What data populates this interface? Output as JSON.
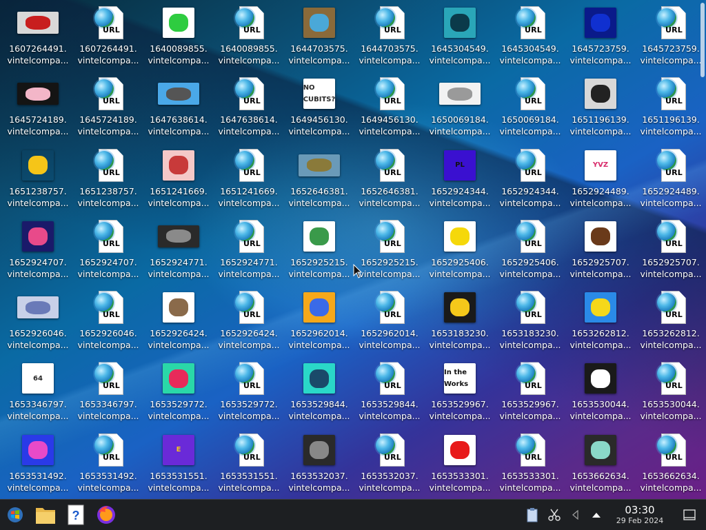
{
  "desktop": {
    "items": [
      {
        "kind": "image",
        "title": "1607264491.",
        "subtitle": "vintelcompa...",
        "thumb": {
          "bg": "#d8d8d8",
          "fg": "#c81e1e",
          "text": "",
          "wide": true
        }
      },
      {
        "kind": "url",
        "title": "1607264491.",
        "subtitle": "vintelcompa..."
      },
      {
        "kind": "image",
        "title": "1640089855.",
        "subtitle": "vintelcompa...",
        "thumb": {
          "bg": "#ffffff",
          "fg": "#2ecc40",
          "text": "",
          "wide": false
        }
      },
      {
        "kind": "url",
        "title": "1640089855.",
        "subtitle": "vintelcompa..."
      },
      {
        "kind": "image",
        "title": "1644703575.",
        "subtitle": "vintelcompa...",
        "thumb": {
          "bg": "#8a6a3a",
          "fg": "#4aa8d8",
          "text": "",
          "wide": false
        }
      },
      {
        "kind": "url",
        "title": "1644703575.",
        "subtitle": "vintelcompa..."
      },
      {
        "kind": "image",
        "title": "1645304549.",
        "subtitle": "vintelcompa...",
        "thumb": {
          "bg": "#2aa6b8",
          "fg": "#0b3a4a",
          "text": "",
          "wide": false
        }
      },
      {
        "kind": "url",
        "title": "1645304549.",
        "subtitle": "vintelcompa..."
      },
      {
        "kind": "image",
        "title": "1645723759.",
        "subtitle": "vintelcompa...",
        "thumb": {
          "bg": "#0a1a8a",
          "fg": "#1030d0",
          "text": "",
          "wide": false
        }
      },
      {
        "kind": "url",
        "title": "1645723759.",
        "subtitle": "vintelcompa..."
      },
      {
        "kind": "image",
        "title": "1645724189.",
        "subtitle": "vintelcompa...",
        "thumb": {
          "bg": "#141414",
          "fg": "#f3b6c8",
          "text": "",
          "wide": true
        }
      },
      {
        "kind": "url",
        "title": "1645724189.",
        "subtitle": "vintelcompa..."
      },
      {
        "kind": "image",
        "title": "1647638614.",
        "subtitle": "vintelcompa...",
        "thumb": {
          "bg": "#4aa8e8",
          "fg": "#555555",
          "text": "",
          "wide": true
        }
      },
      {
        "kind": "url",
        "title": "1647638614.",
        "subtitle": "vintelcompa..."
      },
      {
        "kind": "image",
        "title": "1649456130.",
        "subtitle": "vintelcompa...",
        "thumb": {
          "bg": "#ffffff",
          "fg": "#2a2a2a",
          "text": "NO CUBITS?",
          "wide": false
        }
      },
      {
        "kind": "url",
        "title": "1649456130.",
        "subtitle": "vintelcompa..."
      },
      {
        "kind": "image",
        "title": "1650069184.",
        "subtitle": "vintelcompa...",
        "thumb": {
          "bg": "#f2f2f2",
          "fg": "#9a9a9a",
          "text": "",
          "wide": true
        }
      },
      {
        "kind": "url",
        "title": "1650069184.",
        "subtitle": "vintelcompa..."
      },
      {
        "kind": "image",
        "title": "1651196139.",
        "subtitle": "vintelcompa...",
        "thumb": {
          "bg": "#d8d8d8",
          "fg": "#222222",
          "text": "",
          "wide": false
        }
      },
      {
        "kind": "url",
        "title": "1651196139.",
        "subtitle": "vintelcompa..."
      },
      {
        "kind": "image",
        "title": "1651238757.",
        "subtitle": "vintelcompa...",
        "thumb": {
          "bg": "rgba(0,0,0,0)",
          "fg": "#f5c518",
          "text": "",
          "wide": false
        }
      },
      {
        "kind": "url",
        "title": "1651238757.",
        "subtitle": "vintelcompa..."
      },
      {
        "kind": "image",
        "title": "1651241669.",
        "subtitle": "vintelcompa...",
        "thumb": {
          "bg": "#f4c8c8",
          "fg": "#c83a3a",
          "text": "",
          "wide": false
        }
      },
      {
        "kind": "url",
        "title": "1651241669.",
        "subtitle": "vintelcompa..."
      },
      {
        "kind": "image",
        "title": "1652646381.",
        "subtitle": "vintelcompa...",
        "thumb": {
          "bg": "#6a9ab8",
          "fg": "#8a7a3a",
          "text": "",
          "wide": true
        }
      },
      {
        "kind": "url",
        "title": "1652646381.",
        "subtitle": "vintelcompa..."
      },
      {
        "kind": "image",
        "title": "1652924344.",
        "subtitle": "vintelcompa...",
        "thumb": {
          "bg": "#3a10d0",
          "fg": "#111111",
          "text": "PL",
          "wide": false
        }
      },
      {
        "kind": "url",
        "title": "1652924344.",
        "subtitle": "vintelcompa..."
      },
      {
        "kind": "image",
        "title": "1652924489.",
        "subtitle": "vintelcompa...",
        "thumb": {
          "bg": "#ffffff",
          "fg": "#d82a6a",
          "text": "YVZ",
          "wide": false
        }
      },
      {
        "kind": "url",
        "title": "1652924489.",
        "subtitle": "vintelcompa..."
      },
      {
        "kind": "image",
        "title": "1652924707.",
        "subtitle": "vintelcompa...",
        "thumb": {
          "bg": "#1a1a6a",
          "fg": "#e84a8a",
          "text": "",
          "wide": false
        }
      },
      {
        "kind": "url",
        "title": "1652924707.",
        "subtitle": "vintelcompa..."
      },
      {
        "kind": "image",
        "title": "1652924771.",
        "subtitle": "vintelcompa...",
        "thumb": {
          "bg": "#2a2a2a",
          "fg": "#8a8a8a",
          "text": "",
          "wide": true
        }
      },
      {
        "kind": "url",
        "title": "1652924771.",
        "subtitle": "vintelcompa..."
      },
      {
        "kind": "image",
        "title": "1652925215.",
        "subtitle": "vintelcompa...",
        "thumb": {
          "bg": "#ffffff",
          "fg": "#3a9a4a",
          "text": "",
          "wide": false
        }
      },
      {
        "kind": "url",
        "title": "1652925215.",
        "subtitle": "vintelcompa..."
      },
      {
        "kind": "image",
        "title": "1652925406.",
        "subtitle": "vintelcompa...",
        "thumb": {
          "bg": "#ffffff",
          "fg": "#f5d80a",
          "text": "",
          "wide": false
        }
      },
      {
        "kind": "url",
        "title": "1652925406.",
        "subtitle": "vintelcompa..."
      },
      {
        "kind": "image",
        "title": "1652925707.",
        "subtitle": "vintelcompa...",
        "thumb": {
          "bg": "#ffffff",
          "fg": "#6a3a1a",
          "text": "",
          "wide": false
        }
      },
      {
        "kind": "url",
        "title": "1652925707.",
        "subtitle": "vintelcompa..."
      },
      {
        "kind": "image",
        "title": "1652926046.",
        "subtitle": "vintelcompa...",
        "thumb": {
          "bg": "#c8d0e8",
          "fg": "#6a7ab8",
          "text": "",
          "wide": true
        }
      },
      {
        "kind": "url",
        "title": "1652926046.",
        "subtitle": "vintelcompa..."
      },
      {
        "kind": "image",
        "title": "1652926424.",
        "subtitle": "vintelcompa...",
        "thumb": {
          "bg": "#ffffff",
          "fg": "#8a6a4a",
          "text": "",
          "wide": false
        }
      },
      {
        "kind": "url",
        "title": "1652926424.",
        "subtitle": "vintelcompa..."
      },
      {
        "kind": "image",
        "title": "1652962014.",
        "subtitle": "vintelcompa...",
        "thumb": {
          "bg": "#f5a81a",
          "fg": "#3a6ae8",
          "text": "",
          "wide": false
        }
      },
      {
        "kind": "url",
        "title": "1652962014.",
        "subtitle": "vintelcompa..."
      },
      {
        "kind": "image",
        "title": "1653183230.",
        "subtitle": "vintelcompa...",
        "thumb": {
          "bg": "#1a1a1a",
          "fg": "#f5c81a",
          "text": "",
          "wide": false
        }
      },
      {
        "kind": "url",
        "title": "1653183230.",
        "subtitle": "vintelcompa..."
      },
      {
        "kind": "image",
        "title": "1653262812.",
        "subtitle": "vintelcompa...",
        "thumb": {
          "bg": "#2a8ae8",
          "fg": "#f5d81a",
          "text": "",
          "wide": false
        }
      },
      {
        "kind": "url",
        "title": "1653262812.",
        "subtitle": "vintelcompa..."
      },
      {
        "kind": "image",
        "title": "1653346797.",
        "subtitle": "vintelcompa...",
        "thumb": {
          "bg": "#ffffff",
          "fg": "#2a2a2a",
          "text": "64",
          "wide": false
        }
      },
      {
        "kind": "url",
        "title": "1653346797.",
        "subtitle": "vintelcompa..."
      },
      {
        "kind": "image",
        "title": "1653529772.",
        "subtitle": "vintelcompa...",
        "thumb": {
          "bg": "#2ad8a8",
          "fg": "#e82a5a",
          "text": "",
          "wide": false
        }
      },
      {
        "kind": "url",
        "title": "1653529772.",
        "subtitle": "vintelcompa..."
      },
      {
        "kind": "image",
        "title": "1653529844.",
        "subtitle": "vintelcompa...",
        "thumb": {
          "bg": "#2ad8c8",
          "fg": "#1a4a6a",
          "text": "",
          "wide": false
        }
      },
      {
        "kind": "url",
        "title": "1653529844.",
        "subtitle": "vintelcompa..."
      },
      {
        "kind": "image",
        "title": "1653529967.",
        "subtitle": "vintelcompa...",
        "thumb": {
          "bg": "#ffffff",
          "fg": "#111111",
          "text": "In the Works",
          "wide": false
        }
      },
      {
        "kind": "url",
        "title": "1653529967.",
        "subtitle": "vintelcompa..."
      },
      {
        "kind": "image",
        "title": "1653530044.",
        "subtitle": "vintelcompa...",
        "thumb": {
          "bg": "#1a1a1a",
          "fg": "#ffffff",
          "text": "",
          "wide": false
        }
      },
      {
        "kind": "url",
        "title": "1653530044.",
        "subtitle": "vintelcompa..."
      },
      {
        "kind": "image",
        "title": "1653531492.",
        "subtitle": "vintelcompa...",
        "thumb": {
          "bg": "#2a3ae8",
          "fg": "#e84ac8",
          "text": "",
          "wide": false
        }
      },
      {
        "kind": "url",
        "title": "1653531492.",
        "subtitle": "vintelcompa..."
      },
      {
        "kind": "image",
        "title": "1653531551.",
        "subtitle": "vintelcompa...",
        "thumb": {
          "bg": "#6a2ad8",
          "fg": "#f5c81a",
          "text": "E",
          "wide": false
        }
      },
      {
        "kind": "url",
        "title": "1653531551.",
        "subtitle": "vintelcompa..."
      },
      {
        "kind": "image",
        "title": "1653532037.",
        "subtitle": "vintelcompa...",
        "thumb": {
          "bg": "#2a2a2a",
          "fg": "#888888",
          "text": "",
          "wide": false
        }
      },
      {
        "kind": "url",
        "title": "1653532037.",
        "subtitle": "vintelcompa..."
      },
      {
        "kind": "image",
        "title": "1653533301.",
        "subtitle": "vintelcompa...",
        "thumb": {
          "bg": "#ffffff",
          "fg": "#e81a1a",
          "text": "",
          "wide": false
        }
      },
      {
        "kind": "url",
        "title": "1653533301.",
        "subtitle": "vintelcompa..."
      },
      {
        "kind": "image",
        "title": "1653662634.",
        "subtitle": "vintelcompa...",
        "thumb": {
          "bg": "#2a2a2a",
          "fg": "#8ad8c8",
          "text": "",
          "wide": false
        }
      },
      {
        "kind": "url",
        "title": "1653662634.",
        "subtitle": "vintelcompa..."
      }
    ],
    "url_tag": "URL"
  },
  "taskbar": {
    "launchers": [
      {
        "name": "start-menu-icon"
      },
      {
        "name": "file-manager-icon"
      },
      {
        "name": "help-icon"
      },
      {
        "name": "firefox-icon"
      }
    ],
    "tray_icons": [
      {
        "name": "clipboard-icon"
      },
      {
        "name": "scissors-icon"
      },
      {
        "name": "volume-icon"
      },
      {
        "name": "tray-expand-icon"
      }
    ],
    "clock": {
      "time": "03:30",
      "date": "29 Feb 2024"
    }
  }
}
